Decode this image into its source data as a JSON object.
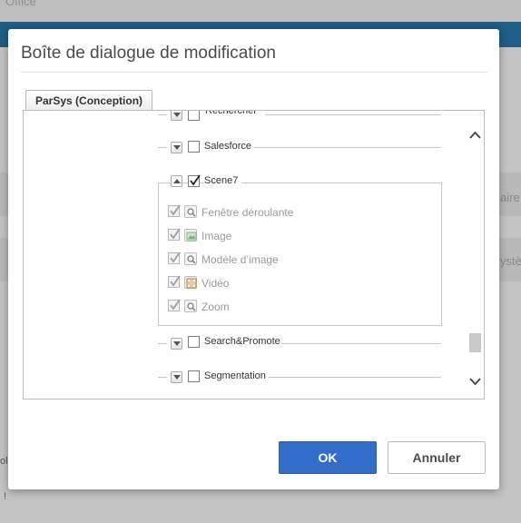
{
  "background": {
    "top_text": "Office",
    "right_text_1": "aire y",
    "right_text_2": "ystè",
    "left_text_1": "ol",
    "left_text_2": "!"
  },
  "dialog": {
    "title": "Boîte de dialogue de modification",
    "tab_label": "ParSys (Conception)",
    "tree": {
      "rechercher": "Rechercher",
      "salesforce": "Salesforce",
      "scene7": "Scene7",
      "scene7_children": [
        {
          "label": "Fenêtre déroulante",
          "icon": "magnifier-icon"
        },
        {
          "label": "Image",
          "icon": "image-icon"
        },
        {
          "label": "Modèle d’image",
          "icon": "magnifier-icon"
        },
        {
          "label": "Vidéo",
          "icon": "film-icon"
        },
        {
          "label": "Zoom",
          "icon": "magnifier-icon"
        }
      ],
      "searchpromote": "Search&Promote",
      "segmentation": "Segmentation"
    },
    "ok_label": "OK",
    "cancel_label": "Annuler"
  },
  "colors": {
    "accent": "#326ec8",
    "overlay": "#c4c4c4",
    "bluebar": "#1f5e86"
  }
}
